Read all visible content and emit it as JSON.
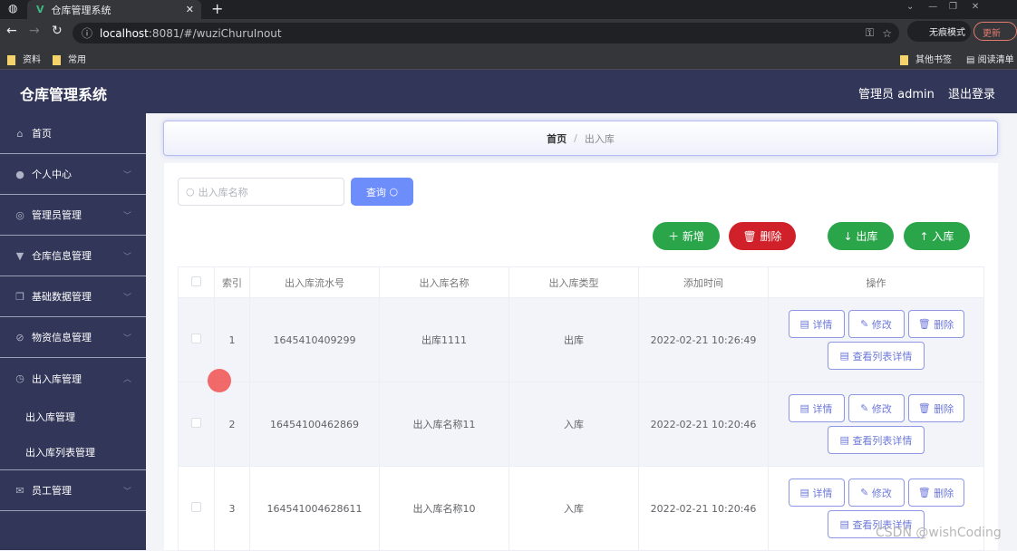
{
  "browser": {
    "tab_title": "仓库管理系统",
    "url_host": "localhost",
    "url_rest": ":8081/#/wuziChuruInout",
    "incognito": "无痕模式",
    "update": "更新",
    "bookmarks": [
      "资料",
      "常用"
    ],
    "other_bookmarks": "其他书签",
    "reading_list": "阅读清单"
  },
  "header": {
    "title": "仓库管理系统",
    "user": "管理员 admin",
    "logout": "退出登录"
  },
  "sidebar": {
    "items": [
      {
        "label": "首页"
      },
      {
        "label": "个人中心"
      },
      {
        "label": "管理员管理"
      },
      {
        "label": "仓库信息管理"
      },
      {
        "label": "基础数据管理"
      },
      {
        "label": "物资信息管理"
      },
      {
        "label": "出入库管理"
      },
      {
        "label": "员工管理"
      }
    ],
    "sub": [
      "出入库管理",
      "出入库列表管理"
    ]
  },
  "breadcrumb": {
    "home": "首页",
    "sep": "/",
    "current": "出入库"
  },
  "search": {
    "placeholder": "出入库名称",
    "button": "查询"
  },
  "actions": {
    "add": "新增",
    "delete": "删除",
    "out": "出库",
    "in": "入库"
  },
  "colors": {
    "sidebar": "#323658",
    "green": "#2aa54a",
    "red": "#d0202a",
    "primary": "#6d8dfb"
  },
  "table": {
    "headers": [
      "索引",
      "出入库流水号",
      "出入库名称",
      "出入库类型",
      "添加时间",
      "操作"
    ],
    "rows": [
      {
        "index": "1",
        "serial": "1645410409299",
        "name": "出库1111",
        "type": "出库",
        "time": "2022-02-21 10:26:49"
      },
      {
        "index": "2",
        "serial": "16454100462869",
        "name": "出入库名称11",
        "type": "入库",
        "time": "2022-02-21 10:20:46"
      },
      {
        "index": "3",
        "serial": "164541004628611",
        "name": "出入库名称10",
        "type": "入库",
        "time": "2022-02-21 10:20:46"
      }
    ],
    "ops": {
      "detail": "详情",
      "edit": "修改",
      "delete": "删除",
      "list_detail": "查看列表详情"
    }
  },
  "watermark": "CSDN @wishCoding"
}
